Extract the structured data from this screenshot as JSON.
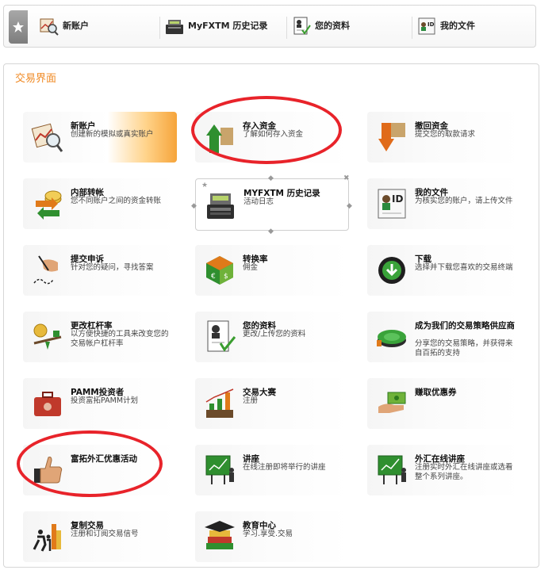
{
  "quickbar": {
    "items": [
      {
        "label": "新账户",
        "icon": "magnifier-chart-icon"
      },
      {
        "label": "MyFXTM 历史记录",
        "icon": "cash-register-icon"
      },
      {
        "label": "您的资料",
        "icon": "profile-document-icon"
      },
      {
        "label": "我的文件",
        "icon": "id-card-icon"
      }
    ]
  },
  "panel": {
    "title": "交易界面",
    "tiles": [
      {
        "title": "新账户",
        "desc": "创建新的模拟或真实账户",
        "icon": "magnifier-chart-icon"
      },
      {
        "title": "存入资金",
        "desc": "了解如何存入资金",
        "icon": "deposit-arrow-icon"
      },
      {
        "title": "撤回资金",
        "desc": "提交您的取款请求",
        "icon": "withdraw-arrow-icon"
      },
      {
        "title": "内部转帐",
        "desc": "您不同账户之间的资金转账",
        "icon": "transfer-arrows-icon"
      },
      {
        "title": "MYFXTM 历史记录",
        "desc": "活动日志",
        "icon": "cash-register-icon"
      },
      {
        "title": "我的文件",
        "desc": "为核实您的账户，请上传文件",
        "icon": "id-card-icon"
      },
      {
        "title": "提交申诉",
        "desc": "针对您的疑问，寻找答案",
        "icon": "hand-pen-icon"
      },
      {
        "title": "转换率",
        "desc": "佣金",
        "icon": "currency-cube-icon"
      },
      {
        "title": "下载",
        "desc": "选择并下载您喜欢的交易终端",
        "icon": "download-icon"
      },
      {
        "title": "更改杠杆率",
        "desc": "以方便快捷的工具来改变您的交易帐户杠杆率",
        "icon": "lever-coin-icon"
      },
      {
        "title": "您的资料",
        "desc": "更改/上传您的资料",
        "icon": "profile-document-icon"
      },
      {
        "title": "成为我们的交易策略供应商",
        "desc": "分享您的交易策略，并获得来自百拓的支持",
        "icon": "strategy-disc-icon"
      },
      {
        "title": "PAMM投资者",
        "desc": "投资富拓PAMM计划",
        "icon": "briefcase-icon"
      },
      {
        "title": "交易大赛",
        "desc": "注册",
        "icon": "contest-chart-icon"
      },
      {
        "title": "赚取优惠券",
        "desc": "",
        "icon": "hand-money-icon"
      },
      {
        "title": "富拓外汇优惠活动",
        "desc": "",
        "icon": "thumbs-up-icon"
      },
      {
        "title": "讲座",
        "desc": "在线注册即将举行的讲座",
        "icon": "seminar-board-icon"
      },
      {
        "title": "外汇在线讲座",
        "desc": "注册实时外汇在线讲座或选看整个系列讲座。",
        "icon": "webinar-board-icon"
      },
      {
        "title": "复制交易",
        "desc": "注册和订阅交易信号",
        "icon": "copy-trade-icon"
      },
      {
        "title": "教育中心",
        "desc": "学习.享受.交易",
        "icon": "books-icon"
      }
    ]
  },
  "colors": {
    "accent": "#f08a24",
    "highlight_circle": "#e8232a"
  }
}
